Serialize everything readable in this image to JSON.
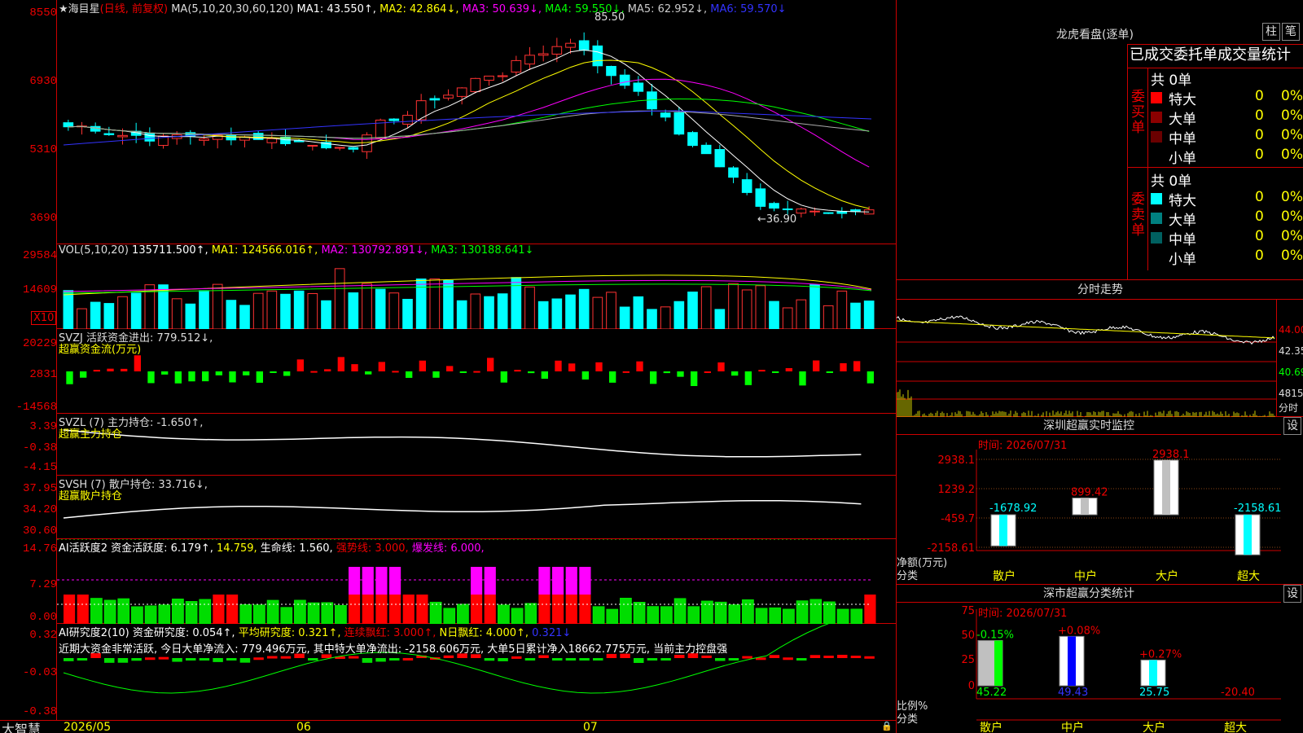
{
  "app": {
    "brand": "大智慧",
    "stock_name": "★海目星",
    "kline_type": "(日线, 前复权)"
  },
  "kline": {
    "params": "MA(5,10,20,30,60,120)",
    "ma1": "MA1: 43.550↑,",
    "ma2": "MA2: 42.864↓,",
    "ma3": "MA3: 50.639↓,",
    "ma4": "MA4: 59.550↓,",
    "ma5": "MA5: 62.952↓,",
    "ma6": "MA6: 59.570↓",
    "y_ticks": [
      "8550",
      "6930",
      "5310",
      "3690"
    ],
    "high_mark": "85.50",
    "low_mark": "←36.90"
  },
  "vol": {
    "params": "VOL(5,10,20)",
    "val": "135711.500↑,",
    "ma1": "MA1: 124566.016↑,",
    "ma2": "MA2: 130792.891↓,",
    "ma3": "MA3: 130188.641↓",
    "y_ticks": [
      "29584",
      "14609"
    ],
    "multiplier": "X10"
  },
  "svzj": {
    "title": "SVZJ  活跃资金进出: 779.512↓,",
    "sub": "超赢资金流(万元)",
    "y_ticks": [
      "20229",
      "2831",
      "-14568"
    ]
  },
  "svzl": {
    "title": "SVZL (7) 主力持仓: -1.650↑,",
    "sub": "超赢主力持仓",
    "y_ticks": [
      "3.39",
      "-0.38",
      "-4.15"
    ]
  },
  "svsh": {
    "title": "SVSH (7) 散户持仓: 33.716↓,",
    "sub": "超赢散户持仓",
    "y_ticks": [
      "37.95",
      "34.20",
      "30.60"
    ]
  },
  "ai1": {
    "t1": "AI活跃度2 资金活跃度: 6.179↑,",
    "t2": "14.759,",
    "t3": "生命线: 1.560,",
    "t4": "强势线: 3.000,",
    "t5": "爆发线: 6.000,",
    "y_ticks": [
      "14.76",
      "7.29",
      "0.00"
    ]
  },
  "ai2": {
    "t1": "AI研究度2(10) 资金研究度: 0.054↑,",
    "t2": "平均研究度: 0.321↑,",
    "t3": "连续飘红: 3.000↑,",
    "t4": "N日飘红: 4.000↑,",
    "t5": "0.321↓",
    "comment": "近期大资金非常活跃, 今日大单净流入: 779.496万元, 其中特大单净流出: -2158.606万元, 大单5日累计净入18662.775万元, 当前主力控盘强",
    "y_ticks": [
      "0.32",
      "-0.03",
      "-0.38"
    ]
  },
  "time_axis": [
    "2026/05",
    "06",
    "07"
  ],
  "longhu": {
    "title": "龙虎看盘(逐单)",
    "btn1": "柱",
    "btn2": "笔",
    "header": "已成交委托单成交量统计",
    "buy": {
      "label": "委买单",
      "total": "共 0单",
      "rows": [
        {
          "name": "特大",
          "v": "0",
          "p": "0%",
          "c": "#ff0000"
        },
        {
          "name": "大单",
          "v": "0",
          "p": "0%",
          "c": "#8b0000"
        },
        {
          "name": "中单",
          "v": "0",
          "p": "0%",
          "c": "#6a0000"
        },
        {
          "name": "小单",
          "v": "0",
          "p": "0%",
          "c": "#000000"
        }
      ]
    },
    "sell": {
      "label": "委卖单",
      "total": "共 0单",
      "rows": [
        {
          "name": "特大",
          "v": "0",
          "p": "0%",
          "c": "#00ffff"
        },
        {
          "name": "大单",
          "v": "0",
          "p": "0%",
          "c": "#008080"
        },
        {
          "name": "中单",
          "v": "0",
          "p": "0%",
          "c": "#006060"
        },
        {
          "name": "小单",
          "v": "0",
          "p": "0%",
          "c": "#000000"
        }
      ]
    }
  },
  "fenshi": {
    "title": "分时走势",
    "y_ticks": [
      "44.00",
      "42.35",
      "40.69",
      "4815"
    ],
    "unit": "分时"
  },
  "sz_monitor": {
    "title": "深圳超赢实时监控",
    "btn": "设",
    "time": "时间: 2026/07/31",
    "y_ticks": [
      "2938.1",
      "1239.2",
      "-459.7",
      "-2158.61"
    ],
    "ylabel1": "净额(万元)",
    "ylabel2": "分类",
    "bars": [
      {
        "cat": "散户",
        "value": -1678.92,
        "label": "-1678.92"
      },
      {
        "cat": "中户",
        "value": 899.42,
        "label": "899.42"
      },
      {
        "cat": "大户",
        "value": 2938.1,
        "label": "2938.1"
      },
      {
        "cat": "超大",
        "value": -2158.61,
        "label": "-2158.61"
      }
    ]
  },
  "sz_stats": {
    "title": "深市超赢分类统计",
    "btn": "设",
    "time": "时间: 2026/07/31",
    "y_ticks": [
      "75",
      "50",
      "25",
      "0"
    ],
    "ylabel1": "比例%",
    "ylabel2": "分类",
    "bars": [
      {
        "cat": "散户",
        "value": 45.22,
        "label": "45.22",
        "chg": "-0.15%"
      },
      {
        "cat": "中户",
        "value": 49.43,
        "label": "49.43",
        "chg": "+0.08%"
      },
      {
        "cat": "大户",
        "value": 25.75,
        "label": "25.75",
        "chg": "+0.27%"
      },
      {
        "cat": "超大",
        "value": -20.4,
        "label": "-20.40",
        "chg": ""
      }
    ]
  },
  "chart_data": {
    "type": "bar",
    "title": "深圳超赢实时监控",
    "categories": [
      "散户",
      "中户",
      "大户",
      "超大"
    ],
    "values": [
      -1678.92,
      899.42,
      2938.1,
      -2158.61
    ],
    "ylabel": "净额(万元)",
    "xlabel": "分类"
  }
}
